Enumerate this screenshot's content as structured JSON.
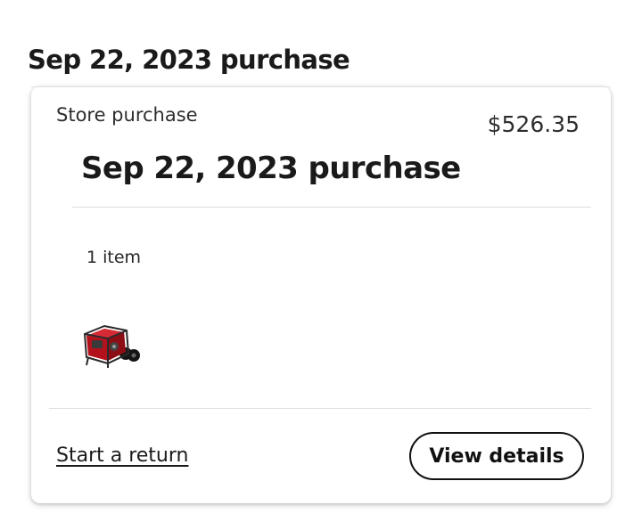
{
  "page": {
    "heading": "Sep 22, 2023 purchase"
  },
  "order": {
    "purchase_type": "Store purchase",
    "total": "$526.35",
    "title": "Sep 22, 2023 purchase",
    "item_count": "1 item",
    "items": [
      {
        "thumbnail_icon": "portable-generator-image",
        "colors": {
          "frame": "#2b2b2b",
          "body": "#b3121c"
        }
      }
    ]
  },
  "actions": {
    "return_label": "Start a return",
    "details_label": "View details"
  }
}
